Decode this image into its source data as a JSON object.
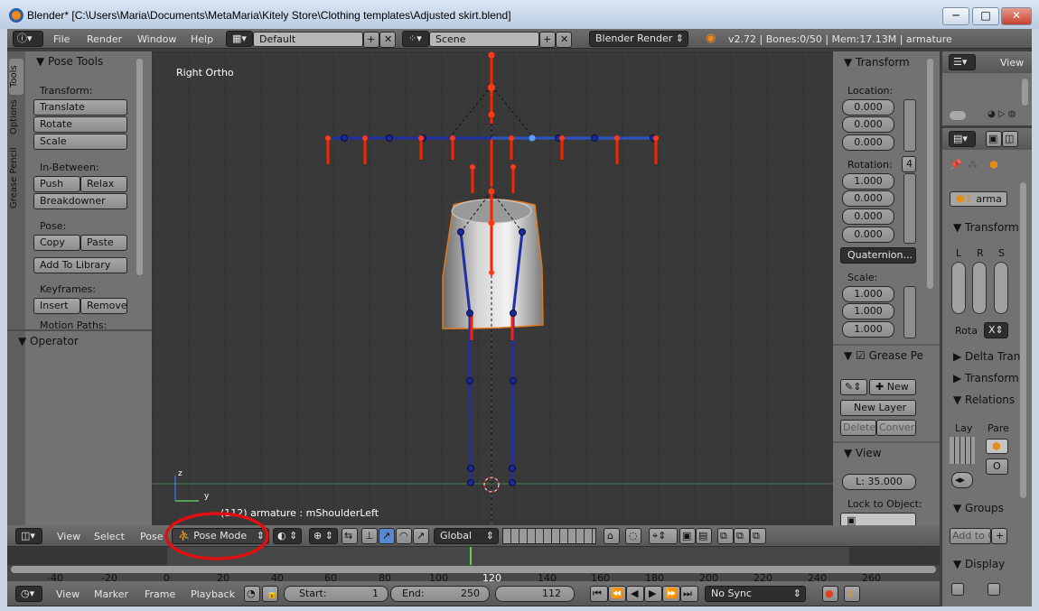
{
  "window": {
    "title": "Blender* [C:\\Users\\Maria\\Documents\\MetaMaria\\Kitely Store\\Clothing templates\\Adjusted skirt.blend]",
    "min": "─",
    "max": "□",
    "close": "✕"
  },
  "info": {
    "menus": [
      "File",
      "Render",
      "Window",
      "Help"
    ],
    "layout": "Default",
    "scene": "Scene",
    "engine": "Blender Render",
    "stats": "v2.72 | Bones:0/50 | Mem:17.13M | armature"
  },
  "left": {
    "tabs": [
      "Tools",
      "Options",
      "Grease Pencil"
    ],
    "pose_tools": "Pose Tools",
    "transform_label": "Transform:",
    "translate": "Translate",
    "rotate": "Rotate",
    "scale": "Scale",
    "inbetween_label": "In-Between:",
    "push": "Push",
    "relax": "Relax",
    "breakdowner": "Breakdowner",
    "pose_label": "Pose:",
    "copy": "Copy",
    "paste": "Paste",
    "add_library": "Add To Library",
    "keyframes_label": "Keyframes:",
    "insert": "Insert",
    "remove": "Remove",
    "motion_paths": "Motion Paths:",
    "operator": "Operator"
  },
  "viewport": {
    "view_name": "Right Ortho",
    "status": "(112) armature : mShoulderLeft",
    "axis_z": "z",
    "axis_y": "y"
  },
  "npanel": {
    "transform": "Transform",
    "location": "Location:",
    "loc": [
      "0.000",
      "0.000",
      "0.000"
    ],
    "rotation": "Rotation:",
    "rot_w": "4",
    "rot": [
      "1.000",
      "0.000",
      "0.000",
      "0.000"
    ],
    "rot_mode": "Quaternion...",
    "scale": "Scale:",
    "scl": [
      "1.000",
      "1.000",
      "1.000"
    ],
    "grease": "Grease Pe",
    "new": "New",
    "new_layer": "New Layer",
    "delete": "Delete",
    "convert": "Convert",
    "view": "View",
    "lens": "L: 35.000",
    "lock": "Lock to Object:"
  },
  "props": {
    "view": "View",
    "object": "arma",
    "transform": "Transform",
    "lrs": [
      "L",
      "R",
      "S"
    ],
    "rota": "Rota",
    "rota_axis": "X",
    "delta": "Delta Tran",
    "transform2": "Transform",
    "relations": "Relations",
    "lay": "Lay",
    "pare": "Pare",
    "o": "O",
    "groups": "Groups",
    "add_to": "Add to G",
    "display": "Display"
  },
  "header3d": {
    "view": "View",
    "select": "Select",
    "pose": "Pose",
    "mode": "Pose Mode",
    "orientation": "Global"
  },
  "timeline": {
    "ticks": [
      "-40",
      "-20",
      "0",
      "20",
      "40",
      "60",
      "80",
      "100",
      "120",
      "140",
      "160",
      "180",
      "200",
      "220",
      "240",
      "260"
    ],
    "view": "View",
    "marker": "Marker",
    "frame": "Frame",
    "playback": "Playback",
    "start_label": "Start:",
    "start": "1",
    "end_label": "End:",
    "end": "250",
    "current": "112",
    "sync": "No Sync"
  },
  "colors": {
    "bone_blue": "#1f2fa6",
    "bone_red": "#ff2200",
    "annotation": "#e01010",
    "panel": "#727272",
    "viewport": "#393939"
  }
}
